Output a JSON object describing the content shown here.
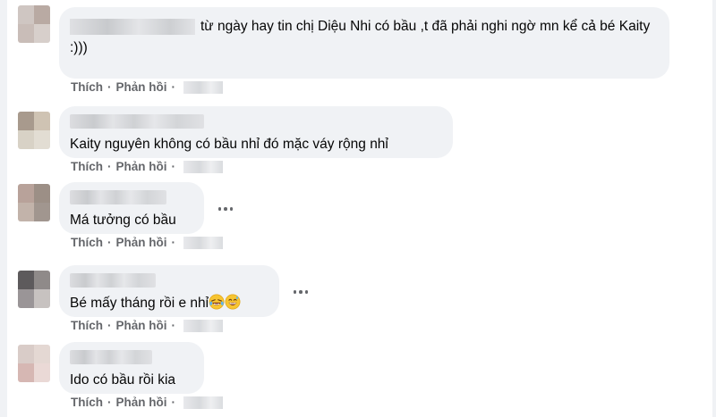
{
  "comments": [
    {
      "text": "từ ngày hay tin chị Diệu Nhi có bầu ,t đã phải nghi ngờ mn kể cả bé Kaity :)))",
      "avatar_colors": [
        "#cfc6c2",
        "#b9aaa3",
        "#c9bdb8",
        "#d7cfcb"
      ]
    },
    {
      "text": "Kaity nguyên không có bầu nhỉ đó mặc váy rộng nhỉ",
      "avatar_colors": [
        "#a89a8d",
        "#cfc3b3",
        "#d8d2c6",
        "#e2ddd3"
      ]
    },
    {
      "text": "Má tưởng có bầu",
      "avatar_colors": [
        "#b8a29a",
        "#9c8f86",
        "#c2b3aa",
        "#a1968f"
      ]
    },
    {
      "text": "Bé mấy tháng rồi e nhỉ",
      "avatar_colors": [
        "#5d5a5c",
        "#8f8a89",
        "#9a9597",
        "#c7c2c0"
      ]
    },
    {
      "text": "Ido có bầu rồi kia",
      "avatar_colors": [
        "#d9ccc8",
        "#e4d8d3",
        "#d6b7b3",
        "#ead9d6"
      ]
    }
  ],
  "actions": {
    "like_label": "Thích",
    "reply_label": "Phản hồi",
    "separator": "·"
  },
  "icons": {
    "more": "more-options-icon",
    "emoji_laugh_tears": "rolling-on-floor-laughing-emoji",
    "emoji_grin_sweat": "grinning-sweat-emoji"
  }
}
